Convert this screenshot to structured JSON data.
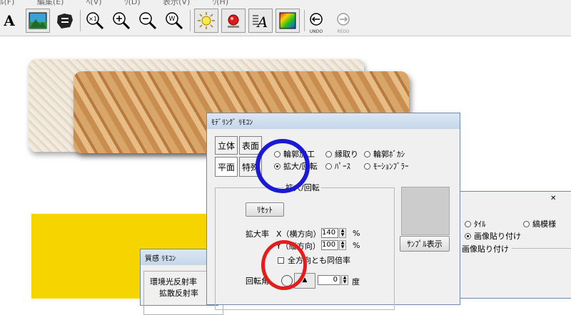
{
  "menubar": {
    "items": [
      "ﾙ(F)",
      "編集(E)",
      "ﾍ(V)",
      "ｳ(D)",
      "表示(V)",
      "ｳ(H)"
    ]
  },
  "toolbar": {
    "text_tool": "A",
    "undo_label": "UNDO",
    "redo_label": "REDO",
    "zoom_in_label": "+",
    "zoom_out_label": "−",
    "zoom_actual_label": "×1",
    "zoom_fit_label": "W"
  },
  "modeling_remote": {
    "title": "ﾓﾃﾞﾘﾝｸﾞ ﾘﾓｺﾝ",
    "tabs": [
      "立体",
      "表面",
      "平面",
      "特殊"
    ],
    "active_tab": "平面",
    "options": [
      {
        "label": "輪郭加工",
        "selected": false
      },
      {
        "label": "縁取り",
        "selected": false
      },
      {
        "label": "輪郭ﾎﾞｶｼ",
        "selected": false
      },
      {
        "label": "拡大/回転",
        "selected": true
      },
      {
        "label": "ﾊﾟｰｽ",
        "selected": false
      },
      {
        "label": "ﾓｰｼｮﾝﾌﾞﾗｰ",
        "selected": false
      }
    ],
    "group_title": "拡大/回転",
    "reset_button": "ﾘｾｯﾄ",
    "scale_label": "拡大率",
    "x_label": "X（横方向）",
    "x_value": "140",
    "y_label": "Y（縦方向）",
    "y_value": "100",
    "percent": "%",
    "same_rate_label": "全方向とも同倍率",
    "same_rate_checked": false,
    "rotation_label": "回転角",
    "rotation_value": "0",
    "degree_unit": "度",
    "sample_button": "ｻﾝﾌﾟﾙ表示"
  },
  "texture_panel": {
    "options": [
      {
        "label": "ﾀｲﾙ",
        "selected": false
      },
      {
        "label": "縞模様",
        "selected": false
      },
      {
        "label": "画像貼り付け",
        "selected": true
      }
    ],
    "group_title": "画像貼り付け"
  },
  "material_remote": {
    "title": "質感 ﾘﾓｺﾝ",
    "ambient_label": "環境光反射率",
    "diffuse_label": "拡散反射率"
  },
  "colors": {
    "annotation_blue": "#1a1ad6",
    "annotation_red": "#e61c1c",
    "yellow_object": "#f5d400"
  }
}
